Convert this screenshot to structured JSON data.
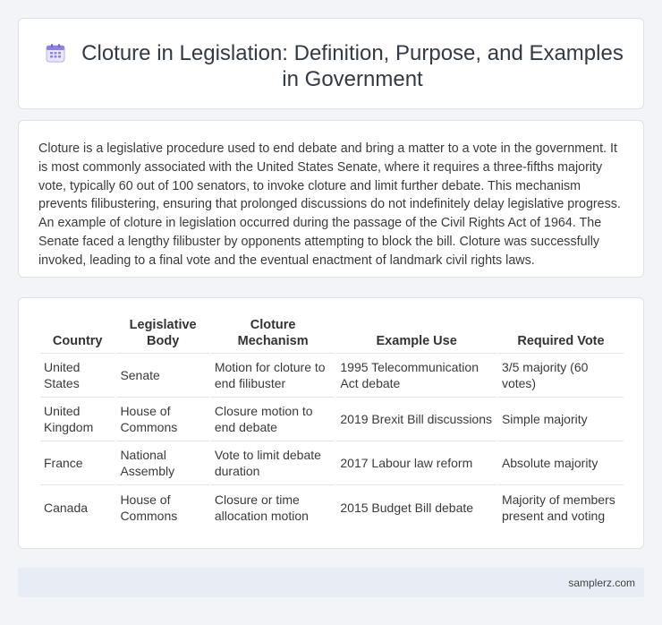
{
  "header": {
    "title": "Cloture in Legislation: Definition, Purpose, and Examples in Government",
    "icon": "calendar-icon"
  },
  "intro": {
    "text": "Cloture is a legislative procedure used to end debate and bring a matter to a vote in the government. It is most commonly associated with the United States Senate, where it requires a three-fifths majority vote, typically 60 out of 100 senators, to invoke cloture and limit further debate. This mechanism prevents filibustering, ensuring that prolonged discussions do not indefinitely delay legislative progress. An example of cloture in legislation occurred during the passage of the Civil Rights Act of 1964. The Senate faced a lengthy filibuster by opponents attempting to block the bill. Cloture was successfully invoked, leading to a final vote and the eventual enactment of landmark civil rights laws."
  },
  "table": {
    "headers": [
      "Country",
      "Legislative Body",
      "Cloture Mechanism",
      "Example Use",
      "Required Vote"
    ],
    "rows": [
      [
        "United States",
        "Senate",
        "Motion for cloture to end filibuster",
        "1995 Telecommunication Act debate",
        "3/5 majority (60 votes)"
      ],
      [
        "United Kingdom",
        "House of Commons",
        "Closure motion to end debate",
        "2019 Brexit Bill discussions",
        "Simple majority"
      ],
      [
        "France",
        "National Assembly",
        "Vote to limit debate duration",
        "2017 Labour law reform",
        "Absolute majority"
      ],
      [
        "Canada",
        "House of Commons",
        "Closure or time allocation motion",
        "2015 Budget Bill debate",
        "Majority of members present and voting"
      ]
    ]
  },
  "footer": {
    "site": "samplerz.com"
  },
  "colors": {
    "background": "#f3f4f8",
    "card": "#ffffff",
    "footer": "#e8ecf5",
    "icon_accent": "#7b6fd6"
  }
}
